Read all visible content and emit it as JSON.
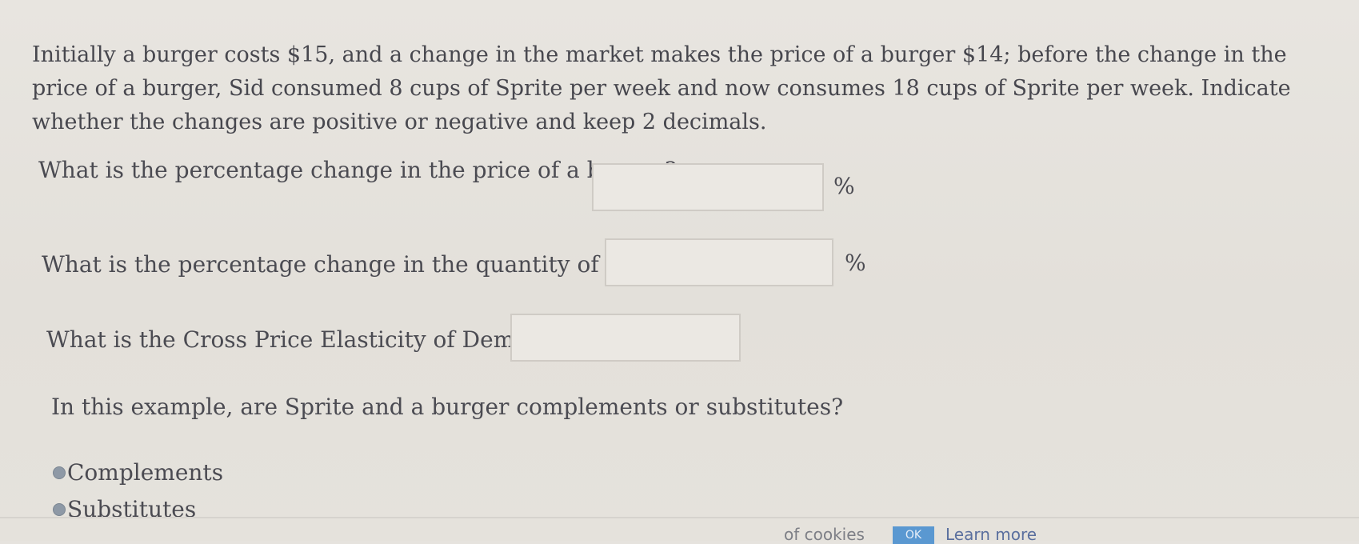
{
  "problem": {
    "intro": "Initially a burger costs $15, and a change in the market makes the price of a burger $14; before the change in the price of a burger, Sid consumed 8 cups of Sprite per week and now consumes 18 cups of Sprite per week. Indicate whether the changes are positive or negative and keep 2 decimals."
  },
  "questions": [
    {
      "label": "What is the percentage change in the price of a burger?",
      "value": "",
      "unit": "%",
      "icon": "pencil-icon"
    },
    {
      "label": "What is the percentage change in the quantity of Sprite?",
      "value": "",
      "unit": "%",
      "icon": "pencil-icon"
    },
    {
      "label": "What is the Cross Price Elasticity of Demand?",
      "value": "",
      "unit": "",
      "icon": "pencil-icon"
    }
  ],
  "relationship": {
    "question": "In this example, are Sprite and a burger complements or substitutes?",
    "options": [
      "Complements",
      "Substitutes"
    ]
  },
  "cookie_banner": {
    "text": "of cookies",
    "ok_label": "OK",
    "learn_more_label": "Learn more"
  },
  "colors": {
    "background": "#e6e3de",
    "text": "#4b4b52",
    "radio": "#8e99a6",
    "ok_button": "#5a98d1",
    "link": "#5a6f9e"
  }
}
